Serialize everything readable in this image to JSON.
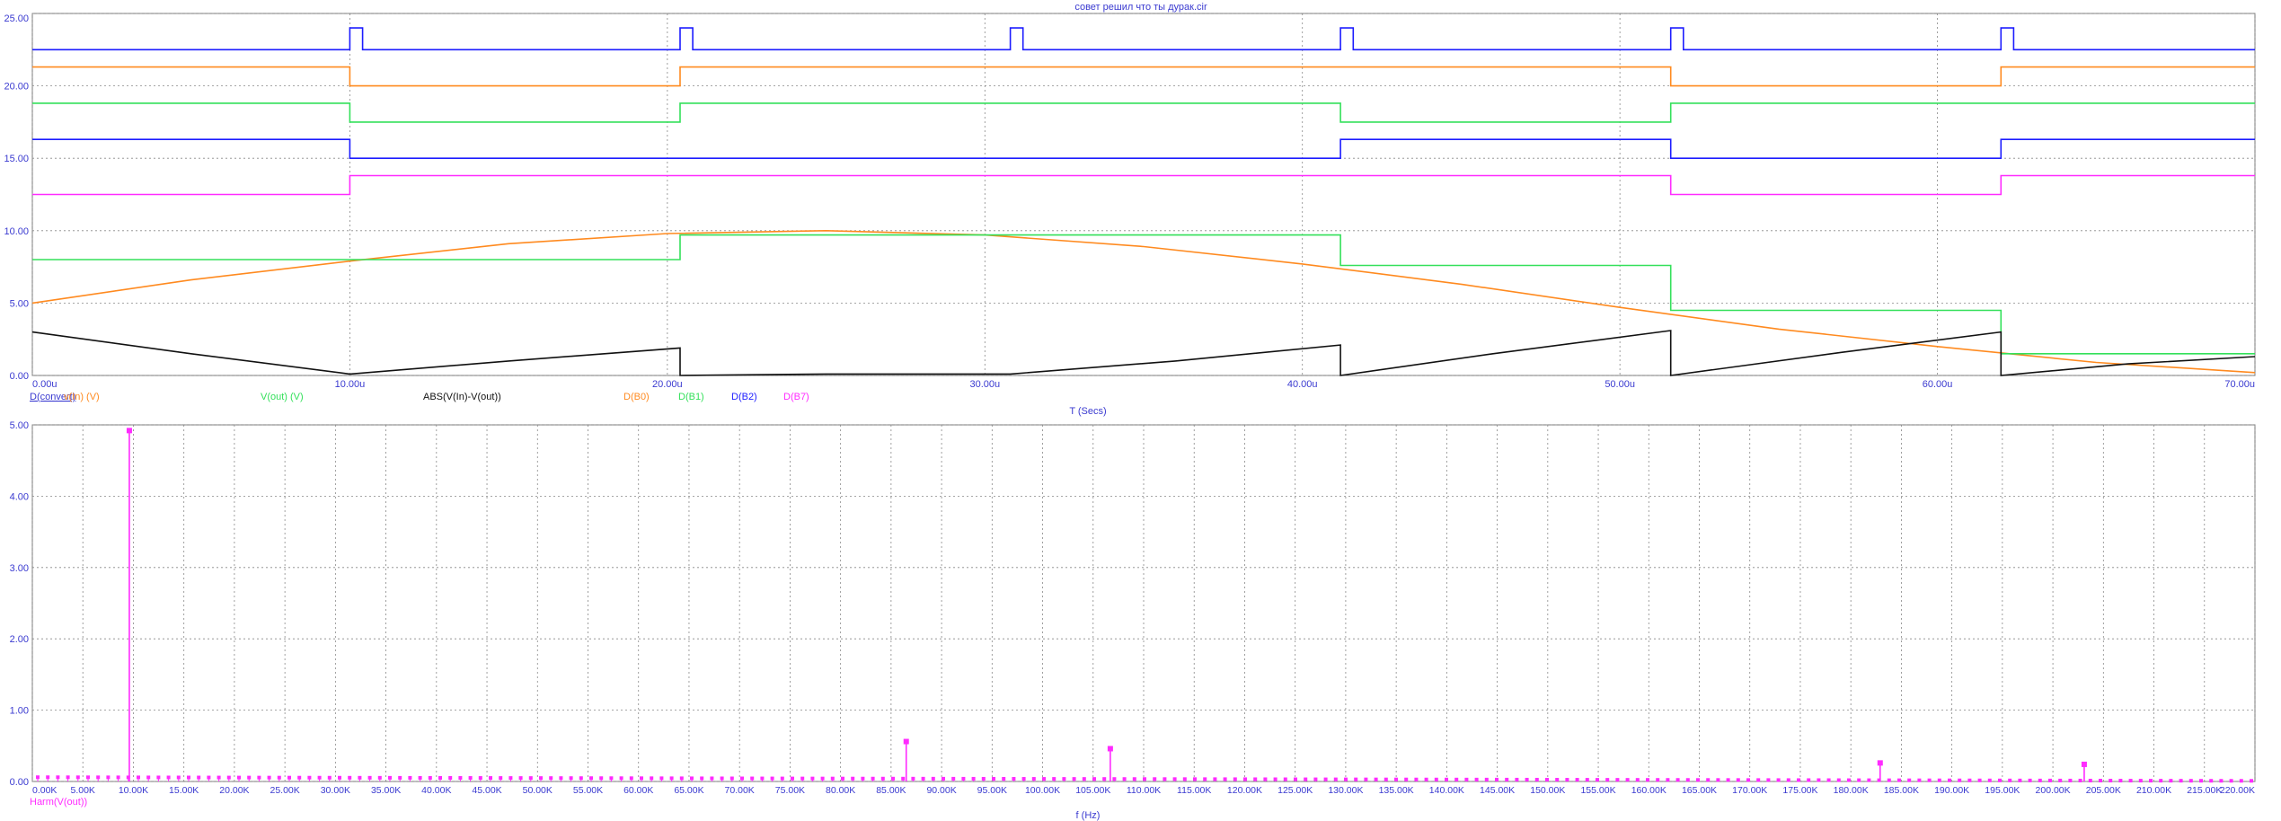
{
  "title": "совет решил что ты дурак.cir",
  "colors": {
    "blue": "#1c1cff",
    "orange": "#ff8a1f",
    "green": "#33e05a",
    "black": "#111111",
    "magenta": "#ff2bff",
    "label_blue": "#3a3ad0",
    "grid": "#888888"
  },
  "chart_data": [
    {
      "type": "line",
      "xlabel": "T (Secs)",
      "xlim": [
        0,
        70
      ],
      "ylim": [
        0,
        25
      ],
      "x_ticks": [
        "0.00u",
        "10.00u",
        "20.00u",
        "30.00u",
        "40.00u",
        "50.00u",
        "60.00u",
        "70.00u"
      ],
      "y_ticks": [
        "0.00",
        "5.00",
        "10.00",
        "15.00",
        "20.00",
        "25.00"
      ],
      "legend": [
        {
          "name": "D(convert)",
          "color": "#1c1cff"
        },
        {
          "name": "v(In) (V)",
          "color": "#ff8a1f"
        },
        {
          "name": "V(out) (V)",
          "color": "#33e05a"
        },
        {
          "name": "ABS(V(In)-V(out))",
          "color": "#111111"
        },
        {
          "name": "D(B0)",
          "color": "#ff8a1f"
        },
        {
          "name": "D(B1)",
          "color": "#33e05a"
        },
        {
          "name": "D(B2)",
          "color": "#1c1cff"
        },
        {
          "name": "D(B7)",
          "color": "#ff2bff"
        }
      ],
      "series": [
        {
          "name": "D(convert)",
          "color": "#1c1cff",
          "x": [
            0,
            10,
            10,
            10.4,
            10.4,
            20.4,
            20.4,
            20.8,
            20.8,
            30.8,
            30.8,
            31.2,
            31.2,
            41.2,
            41.2,
            41.6,
            41.6,
            51.6,
            51.6,
            52,
            52,
            62,
            62,
            62.4,
            62.4,
            70
          ],
          "y": [
            22.5,
            22.5,
            24,
            24,
            22.5,
            22.5,
            24,
            24,
            22.5,
            22.5,
            24,
            24,
            22.5,
            22.5,
            24,
            24,
            22.5,
            22.5,
            24,
            24,
            22.5,
            22.5,
            24,
            24,
            22.5,
            22.5
          ]
        },
        {
          "name": "D(B0)",
          "color": "#ff8a1f",
          "x": [
            0,
            10,
            10,
            20.4,
            20.4,
            51.6,
            51.6,
            62,
            62,
            70
          ],
          "y": [
            21.3,
            21.3,
            20,
            20,
            21.3,
            21.3,
            20,
            20,
            21.3,
            21.3
          ]
        },
        {
          "name": "D(B1)",
          "color": "#33e05a",
          "x": [
            0,
            10,
            10,
            20.4,
            20.4,
            41.2,
            41.2,
            51.6,
            51.6,
            70
          ],
          "y": [
            18.8,
            18.8,
            17.5,
            17.5,
            18.8,
            18.8,
            17.5,
            17.5,
            18.8,
            18.8
          ]
        },
        {
          "name": "D(B2)",
          "color": "#1c1cff",
          "x": [
            0,
            10,
            10,
            41.2,
            41.2,
            51.6,
            51.6,
            62,
            62,
            70
          ],
          "y": [
            16.3,
            16.3,
            15,
            15,
            16.3,
            16.3,
            15,
            15,
            16.3,
            16.3
          ]
        },
        {
          "name": "D(B7)",
          "color": "#ff2bff",
          "x": [
            0,
            10,
            10,
            51.6,
            51.6,
            62,
            62,
            70
          ],
          "y": [
            12.5,
            12.5,
            13.8,
            13.8,
            12.5,
            12.5,
            13.8,
            13.8
          ]
        },
        {
          "name": "v(In) (V)",
          "color": "#ff8a1f",
          "x": [
            0,
            5,
            10,
            15,
            20,
            25,
            30,
            35,
            40,
            45,
            50,
            55,
            60,
            65,
            70
          ],
          "y": [
            5.0,
            6.6,
            7.9,
            9.1,
            9.8,
            10.0,
            9.7,
            8.9,
            7.7,
            6.3,
            4.7,
            3.2,
            2.0,
            0.9,
            0.2
          ]
        },
        {
          "name": "V(out) (V)",
          "color": "#33e05a",
          "x": [
            0,
            10,
            10,
            20.4,
            20.4,
            41.2,
            41.2,
            51.6,
            51.6,
            62,
            62,
            70
          ],
          "y": [
            8.0,
            8.0,
            8.0,
            8.0,
            9.7,
            9.7,
            7.6,
            7.6,
            4.5,
            4.5,
            1.5,
            1.5
          ]
        },
        {
          "name": "ABS(V(In)-V(out))",
          "color": "#111111",
          "x": [
            0,
            5,
            10,
            15,
            20.4,
            20.4,
            25,
            30,
            30.8,
            36,
            41.2,
            41.2,
            46,
            51.6,
            51.6,
            57,
            62,
            62,
            66,
            70
          ],
          "y": [
            3.0,
            1.5,
            0.1,
            1.0,
            1.9,
            0.0,
            0.1,
            0.1,
            0.1,
            1.0,
            2.1,
            0.0,
            1.5,
            3.1,
            0.0,
            1.6,
            3.0,
            0.0,
            0.8,
            1.3
          ]
        }
      ]
    },
    {
      "type": "bar",
      "style": "stem",
      "xlabel": "f (Hz)",
      "xlim": [
        0,
        220
      ],
      "ylim": [
        0,
        5
      ],
      "x_ticks": [
        "0.00K",
        "5.00K",
        "10.00K",
        "15.00K",
        "20.00K",
        "25.00K",
        "30.00K",
        "35.00K",
        "40.00K",
        "45.00K",
        "50.00K",
        "55.00K",
        "60.00K",
        "65.00K",
        "70.00K",
        "75.00K",
        "80.00K",
        "85.00K",
        "90.00K",
        "95.00K",
        "100.00K",
        "105.00K",
        "110.00K",
        "115.00K",
        "120.00K",
        "125.00K",
        "130.00K",
        "135.00K",
        "140.00K",
        "145.00K",
        "150.00K",
        "155.00K",
        "160.00K",
        "165.00K",
        "170.00K",
        "175.00K",
        "180.00K",
        "185.00K",
        "190.00K",
        "195.00K",
        "200.00K",
        "205.00K",
        "210.00K",
        "215.00K",
        "220.00K"
      ],
      "y_ticks": [
        "0.00",
        "1.00",
        "2.00",
        "3.00",
        "4.00",
        "5.00"
      ],
      "legend": [
        {
          "name": "Harm(V(out))",
          "color": "#ff2bff"
        }
      ],
      "series": [
        {
          "name": "Harm(V(out))",
          "color": "#ff2bff",
          "x": [
            9.6,
            86.5,
            106.7,
            182.9,
            203.1
          ],
          "values": [
            4.92,
            0.56,
            0.46,
            0.26,
            0.24
          ]
        }
      ],
      "noise_floor": 0.06
    }
  ]
}
